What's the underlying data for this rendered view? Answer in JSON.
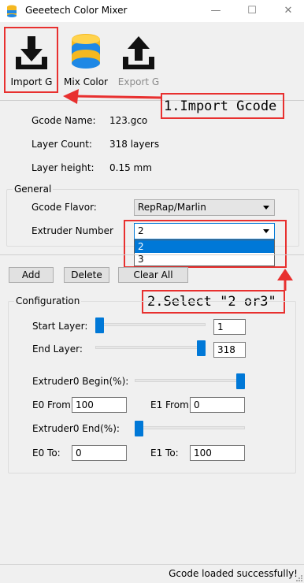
{
  "window": {
    "title": "Geeetech Color Mixer",
    "minimize": "—",
    "maximize": "☐",
    "close": "✕"
  },
  "toolbar": {
    "import_label": "Import G",
    "mix_label": "Mix Color",
    "export_label": "Export G"
  },
  "annotations": {
    "step1": "1.Import Gcode",
    "step2": "2.Select \"2 or3\""
  },
  "info": {
    "gcode_name_label": "Gcode Name:",
    "gcode_name_value": "123.gco",
    "layer_count_label": "Layer Count:",
    "layer_count_value": "318 layers",
    "layer_height_label": "Layer height:",
    "layer_height_value": "0.15 mm"
  },
  "general": {
    "title": "General",
    "flavor_label": "Gcode Flavor:",
    "flavor_value": "RepRap/Marlin",
    "extruder_label": "Extruder Number",
    "extruder_value": "2",
    "extruder_options": [
      "2",
      "3"
    ]
  },
  "actions": {
    "add": "Add",
    "delete": "Delete",
    "clear_all": "Clear All"
  },
  "configuration": {
    "title": "Configuration",
    "start_layer_label": "Start Layer:",
    "start_layer_value": "1",
    "start_layer_level": 0,
    "end_layer_label": "End Layer:",
    "end_layer_value": "318",
    "end_layer_level": 1,
    "extruder0_begin_label": "Extruder0 Begin(%):",
    "extruder0_begin_level": 1,
    "e0_from_label": "E0 From:",
    "e0_from_value": "100",
    "e1_from_label": "E1 From:",
    "e1_from_value": "0",
    "extruder0_end_label": "Extruder0 End(%):",
    "extruder0_end_level": 0,
    "e0_to_label": "E0 To:",
    "e0_to_value": "0",
    "e1_to_label": "E1 To:",
    "e1_to_value": "100"
  },
  "status": {
    "text": "Gcode loaded successfully!"
  },
  "colors": {
    "accent": "#0078d7",
    "annotation_red": "#e8302f",
    "db_blue": "#1e88e5",
    "db_yellow": "#f5b820"
  }
}
